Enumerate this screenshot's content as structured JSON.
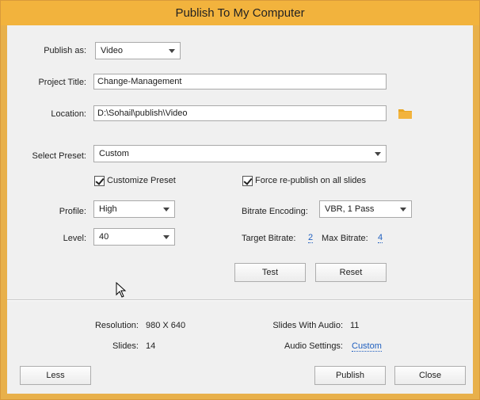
{
  "window": {
    "title": "Publish To My Computer"
  },
  "form": {
    "publish_as_label": "Publish as:",
    "publish_as_value": "Video",
    "project_title_label": "Project Title:",
    "project_title_value": "Change-Management",
    "location_label": "Location:",
    "location_value": "D:\\Sohail\\publish\\Video",
    "select_preset_label": "Select Preset:",
    "select_preset_value": "Custom",
    "customize_preset_label": "Customize Preset",
    "customize_preset_checked": true,
    "force_republish_label": "Force re-publish on all slides",
    "force_republish_checked": true,
    "profile_label": "Profile:",
    "profile_value": "High",
    "level_label": "Level:",
    "level_value": "40",
    "bitrate_encoding_label": "Bitrate Encoding:",
    "bitrate_encoding_value": "VBR, 1 Pass",
    "target_bitrate_label": "Target Bitrate:",
    "target_bitrate_value": "2",
    "max_bitrate_label": "Max Bitrate:",
    "max_bitrate_value": "4",
    "test_label": "Test",
    "reset_label": "Reset"
  },
  "info": {
    "resolution_label": "Resolution:",
    "resolution_value": "980 X 640",
    "slides_label": "Slides:",
    "slides_value": "14",
    "slides_with_audio_label": "Slides With Audio:",
    "slides_with_audio_value": "11",
    "audio_settings_label": "Audio Settings:",
    "audio_settings_value": "Custom"
  },
  "footer": {
    "less_label": "Less",
    "publish_label": "Publish",
    "close_label": "Close"
  },
  "colors": {
    "titlebar": "#f2b33d",
    "link": "#1f5fbf",
    "folder": "#e8a623"
  },
  "icons": [
    "folder-icon",
    "mouse-cursor-icon",
    "dropdown-caret-icon",
    "checkmark-icon"
  ]
}
